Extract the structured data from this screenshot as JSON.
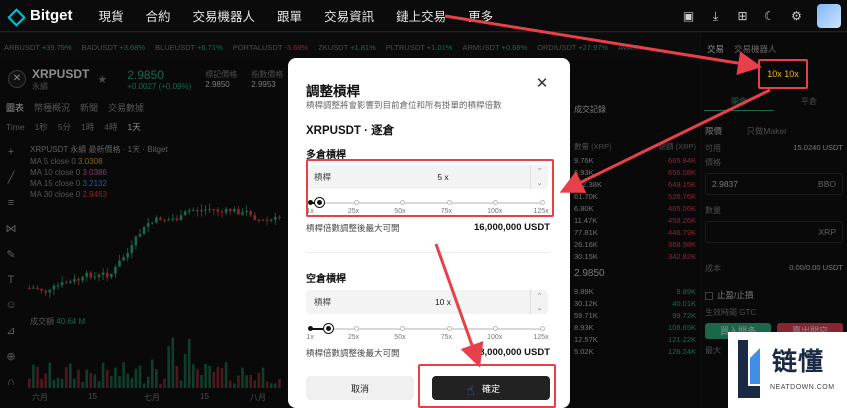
{
  "nav": {
    "brand": "Bitget",
    "items": [
      "現貨",
      "合約",
      "交易機器人",
      "跟單",
      "交易資訊",
      "鏈上交易",
      "更多"
    ],
    "icons": [
      "wallet-icon",
      "download-icon",
      "qr-icon",
      "moon-icon",
      "gear-icon"
    ]
  },
  "ticker": [
    {
      "sym": "ARBUSDT",
      "chg": "+39.79%",
      "dir": "up"
    },
    {
      "sym": "BADUSDT",
      "chg": "+3.68%",
      "dir": "up"
    },
    {
      "sym": "BLUEUSDT",
      "chg": "+6.71%",
      "dir": "up"
    },
    {
      "sym": "PORTALUSDT",
      "chg": "-3.68%",
      "dir": "dn"
    },
    {
      "sym": "ZKUSDT",
      "chg": "+1.81%",
      "dir": "up"
    },
    {
      "sym": "PLTRUSDT",
      "chg": "+1.01%",
      "dir": "up"
    },
    {
      "sym": "ARMUSDT",
      "chg": "+0.68%",
      "dir": "up"
    },
    {
      "sym": "ORDIUSDT",
      "chg": "+27.97%",
      "dir": "up"
    },
    {
      "sym": "AVAX",
      "chg": "",
      "dir": "up"
    }
  ],
  "pair": {
    "name": "XRPUSDT",
    "sub": "永續",
    "price": "2.9850",
    "change": "+0.0027 (+0.09%)",
    "stats": [
      {
        "label": "標記價格",
        "value": "2.9850"
      },
      {
        "label": "指數價格",
        "value": "2.9953"
      }
    ]
  },
  "chart_tabs": [
    "圖表",
    "幣種概況",
    "新聞",
    "交易數據"
  ],
  "time_tabs": [
    "Time",
    "1秒",
    "5分",
    "1時",
    "4時",
    "1天"
  ],
  "chart": {
    "title": "XRPUSDT 永續 最新價格 · 1天 · Bitget",
    "ma": [
      {
        "name": "MA 5 close 0",
        "value": "3.0308",
        "color": "#f0b90b"
      },
      {
        "name": "MA 10 close 0",
        "value": "3.0386",
        "color": "#e56cc8"
      },
      {
        "name": "MA 15 close 0",
        "value": "3.2132",
        "color": "#4aa3ff"
      },
      {
        "name": "MA 30 close 0",
        "value": "2.9463",
        "color": "#f6465d"
      }
    ],
    "volume_label": "成交額",
    "volume_value": "40.64 M",
    "x_labels": [
      "六月",
      "15",
      "七月",
      "15",
      "八月"
    ]
  },
  "orderbook": {
    "tab": "成交記錄",
    "head": [
      "數量 (XRP)",
      "總額 (XRP)"
    ],
    "asks": [
      [
        "9.76K",
        "665.84K"
      ],
      [
        "6.93K",
        "656.08K"
      ],
      [
        "122.38K",
        "649.15K"
      ],
      [
        "61.70K",
        "526.76K"
      ],
      [
        "6.80K",
        "465.06K"
      ],
      [
        "11.47K",
        "458.26K"
      ],
      [
        "77.81K",
        "446.79K"
      ],
      [
        "26.16K",
        "368.98K"
      ],
      [
        "30.15K",
        "342.82K"
      ]
    ],
    "mid": "2.9850",
    "bids": [
      [
        "9.89K",
        "9.89K"
      ],
      [
        "30.12K",
        "40.01K"
      ],
      [
        "59.71K",
        "99.72K"
      ],
      [
        "8.93K",
        "108.65K"
      ],
      [
        "12.57K",
        "121.22K"
      ],
      [
        "5.02K",
        "126.24K"
      ]
    ]
  },
  "right_panel": {
    "tabs": [
      "交易",
      "交易機器人"
    ],
    "leverage_label": "10x 10x",
    "modes": [
      "開倉",
      "平倉"
    ],
    "order_type": "限價",
    "maker": "只做Maker",
    "available_label": "可用",
    "available_value": "15.0240 USDT",
    "price_label": "價格",
    "price_value": "2.9837",
    "price_unit": "BBO",
    "qty_label": "數量",
    "qty_unit": "XRP",
    "cost_label": "成本",
    "cost_value": "0.00/0.00 USDT",
    "tpsl_label": "止盈/止損",
    "tif_label": "生效時間 GTC",
    "long_button": "買入開多",
    "short_button": "賣出開空",
    "max_label": "最大"
  },
  "modal": {
    "title": "調整槓桿",
    "subtitle": "槓桿調整將會影響到目前倉位和所有掛單的槓桿倍數",
    "pair": "XRPUSDT · 逐倉",
    "long": {
      "section": "多倉槓桿",
      "input_label": "槓桿",
      "value": "5 x",
      "fraction": 0.04,
      "max_label": "槓桿倍數調整後最大可開",
      "max_value": "16,000,000 USDT"
    },
    "short": {
      "section": "空倉槓桿",
      "input_label": "槓桿",
      "value": "10 x",
      "fraction": 0.081,
      "max_label": "槓桿倍數調整後最大可開",
      "max_value": "8,000,000 USDT"
    },
    "ticks": [
      "1x",
      "25x",
      "50x",
      "75x",
      "100x",
      "125x"
    ],
    "cancel": "取消",
    "confirm": "確定"
  },
  "watermark": {
    "text": "链懂",
    "sub": "NEATDOWN.COM"
  },
  "colors": {
    "up": "#2ebd85",
    "down": "#f6465d",
    "annotation": "#e8404a",
    "leverage": "#f0b90b"
  }
}
